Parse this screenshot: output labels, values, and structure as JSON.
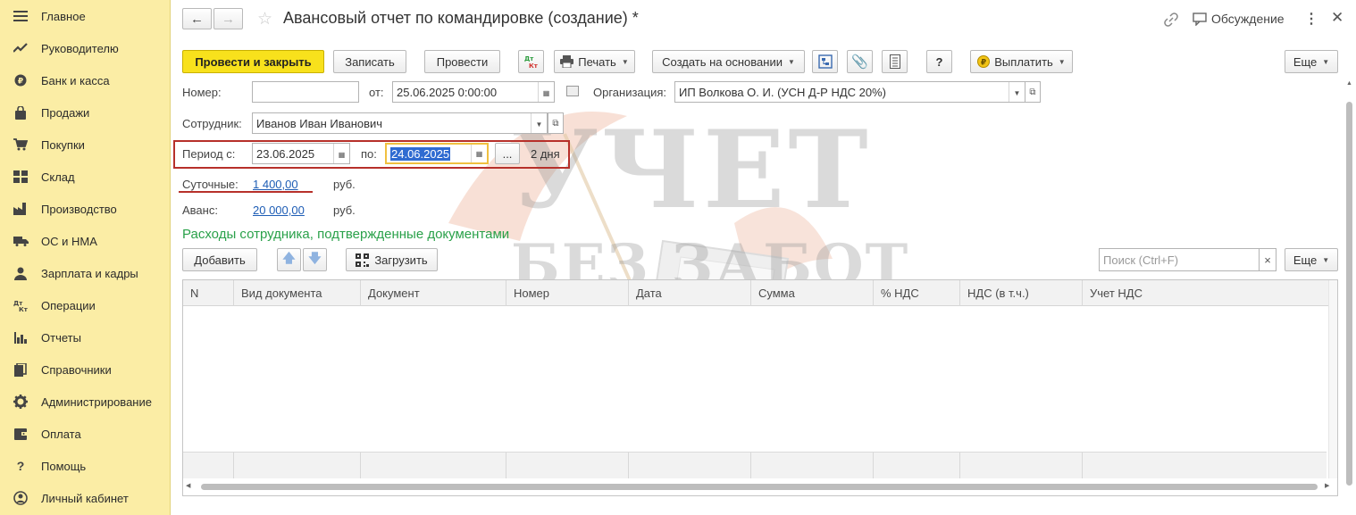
{
  "sidebar": {
    "items": [
      {
        "label": "Главное",
        "icon": "menu-lines-icon"
      },
      {
        "label": "Руководителю",
        "icon": "trend-icon"
      },
      {
        "label": "Банк и касса",
        "icon": "coin-icon"
      },
      {
        "label": "Продажи",
        "icon": "bag-icon"
      },
      {
        "label": "Покупки",
        "icon": "cart-icon"
      },
      {
        "label": "Склад",
        "icon": "warehouse-icon"
      },
      {
        "label": "Производство",
        "icon": "factory-icon"
      },
      {
        "label": "ОС и НМА",
        "icon": "truck-icon"
      },
      {
        "label": "Зарплата и кадры",
        "icon": "person-icon"
      },
      {
        "label": "Операции",
        "icon": "dt-kt-icon"
      },
      {
        "label": "Отчеты",
        "icon": "bar-chart-icon"
      },
      {
        "label": "Справочники",
        "icon": "book-icon"
      },
      {
        "label": "Администрирование",
        "icon": "gear-icon"
      },
      {
        "label": "Оплата",
        "icon": "wallet-icon"
      },
      {
        "label": "Помощь",
        "icon": "question-icon"
      },
      {
        "label": "Личный кабинет",
        "icon": "user-circle-icon"
      }
    ]
  },
  "header": {
    "title": "Авансовый отчет по командировке (создание) *",
    "discussion_label": "Обсуждение"
  },
  "toolbar": {
    "post_close": "Провести и закрыть",
    "save": "Записать",
    "post": "Провести",
    "dtkt": "Дт Кт",
    "print": "Печать",
    "create_based": "Создать на основании",
    "help": "?",
    "pay": "Выплатить",
    "more": "Еще"
  },
  "form": {
    "number_label": "Номер:",
    "number_value": "",
    "date_label": "от:",
    "date_value": "25.06.2025  0:00:00",
    "org_label": "Организация:",
    "org_value": "ИП Волкова О. И. (УСН Д-Р НДС 20%)",
    "employee_label": "Сотрудник:",
    "employee_value": "Иванов Иван Иванович",
    "period_from_label": "Период с:",
    "period_from_value": "23.06.2025",
    "period_to_label": "по:",
    "period_to_value": "24.06.2025",
    "period_dots": "...",
    "period_days": "2 дня",
    "per_diem_label": "Суточные:",
    "per_diem_value": "1 400,00",
    "advance_label": "Аванс:",
    "advance_value": "20 000,00",
    "currency": "руб."
  },
  "expenses": {
    "section_title": "Расходы сотрудника, подтвержденные документами",
    "add_label": "Добавить",
    "load_label": "Загрузить",
    "search_placeholder": "Поиск (Ctrl+F)",
    "clear": "×",
    "more": "Еще",
    "columns": [
      "N",
      "Вид документа",
      "Документ",
      "Номер",
      "Дата",
      "Сумма",
      "% НДС",
      "НДС (в т.ч.)",
      "Учет НДС"
    ],
    "rows": []
  },
  "watermark": {
    "line1": "УЧЕТ",
    "line2": "БЕЗ ЗАБОТ"
  },
  "colors": {
    "sidebar_bg": "#fbeda5",
    "primary_button": "#f8e11c",
    "link": "#1e5db5",
    "section_title": "#2aa14a",
    "highlight_frame": "#b7302a",
    "selection": "#2f6bd1"
  }
}
